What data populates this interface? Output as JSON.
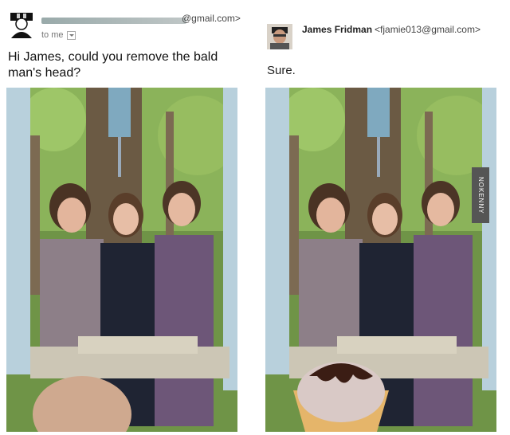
{
  "left": {
    "sender_domain": "@gmail.com>",
    "to_me": "to me",
    "message": "Hi James, could you remove the bald man's head?"
  },
  "right": {
    "sender_name": "James Fridman",
    "sender_email": "<fjamie013@gmail.com>",
    "reply": "Sure."
  },
  "watermark": "NOKENNY",
  "icons": {
    "sender_avatar": "cartoon-avatar-icon",
    "reply_avatar": "man-with-cap-avatar",
    "to_me_dropdown": "chevron-down-icon"
  }
}
